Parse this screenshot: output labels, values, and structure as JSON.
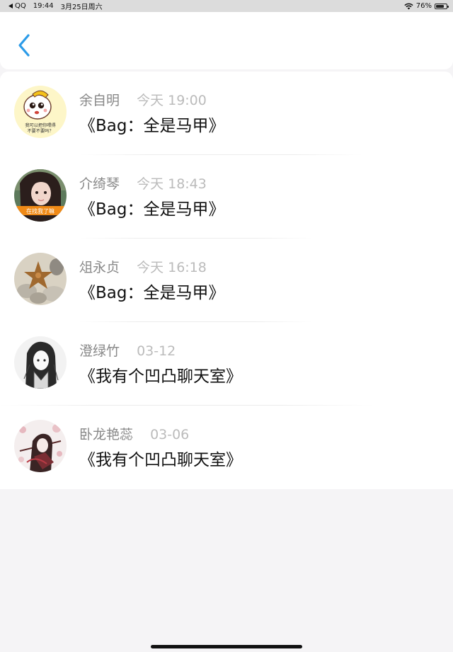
{
  "status_bar": {
    "back_app": "QQ",
    "time": "19:44",
    "date": "3月25日周六",
    "battery": "76%",
    "battery_level": 0.76
  },
  "icons": {
    "back": "chevron-left-icon",
    "wifi": "wifi-icon",
    "battery": "battery-icon"
  },
  "items": [
    {
      "name": "余自明",
      "time": "今天 19:00",
      "title": "《Bag：全是马甲》"
    },
    {
      "name": "介绮琴",
      "time": "今天 18:43",
      "title": "《Bag：全是马甲》"
    },
    {
      "name": "俎永贞",
      "time": "今天 16:18",
      "title": "《Bag：全是马甲》"
    },
    {
      "name": "澄绿竹",
      "time": "03-12",
      "title": "《我有个凹凸聊天室》"
    },
    {
      "name": "卧龙艳蕊",
      "time": "03-06",
      "title": "《我有个凹凸聊天室》"
    }
  ],
  "avatar_texts": {
    "item0": [
      "我可以把你喂得",
      "不要不要吗？"
    ],
    "item1": "在找我了嘛"
  },
  "colors": {
    "accent": "#2b9be8",
    "background": "#f5f4f6",
    "name": "#888888",
    "time": "#bbbbbb",
    "title": "#111111"
  }
}
